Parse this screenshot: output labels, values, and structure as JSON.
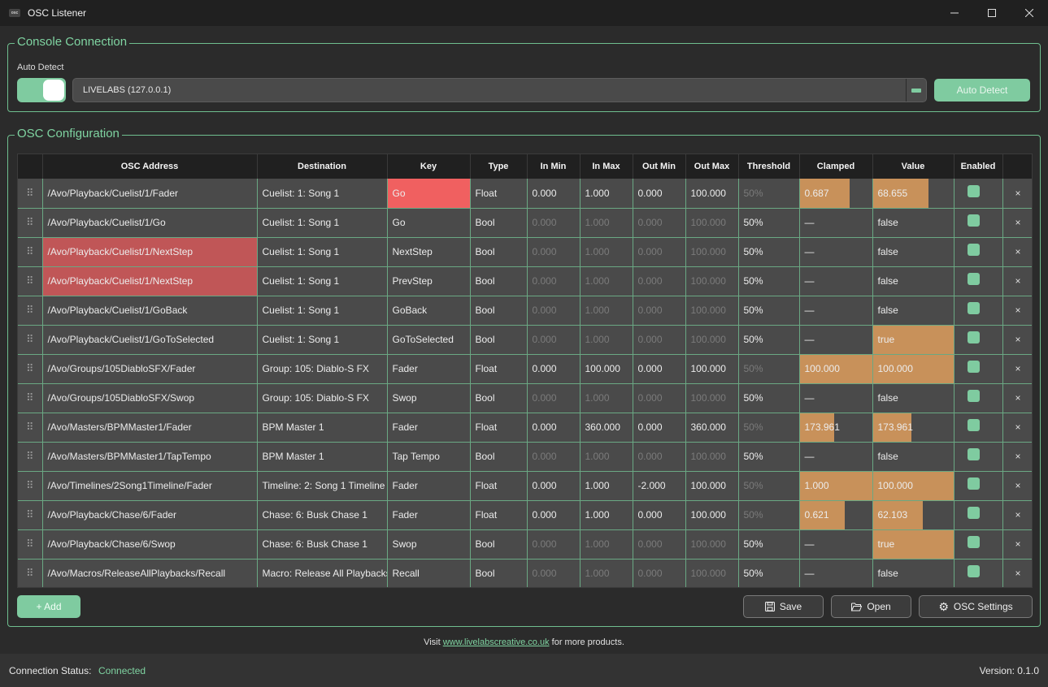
{
  "window": {
    "title": "OSC Listener",
    "icon_text": "osc"
  },
  "console": {
    "group_title": "Console Connection",
    "auto_detect_label": "Auto Detect",
    "toggle_on": true,
    "selected_console": "LIVELABS (127.0.0.1)",
    "auto_detect_button": "Auto Detect"
  },
  "osc": {
    "group_title": "OSC Configuration",
    "columns": [
      "",
      "OSC Address",
      "Destination",
      "Key",
      "Type",
      "In Min",
      "In Max",
      "Out Min",
      "Out Max",
      "Threshold",
      "Clamped",
      "Value",
      "Enabled",
      ""
    ],
    "rows": [
      {
        "address": "/Avo/Playback/Cuelist/1/Fader",
        "destination": "Cuelist: 1: Song 1",
        "key": "Go",
        "type": "Float",
        "in_min": "0.000",
        "in_max": "1.000",
        "out_min": "0.000",
        "out_max": "100.000",
        "threshold": "50%",
        "clamped": "0.687",
        "clamped_fill": 0.687,
        "value": "68.655",
        "value_fill": 0.687,
        "enabled": true,
        "address_error": false,
        "key_error": true,
        "numeric_active": true
      },
      {
        "address": "/Avo/Playback/Cuelist/1/Go",
        "destination": "Cuelist: 1: Song 1",
        "key": "Go",
        "type": "Bool",
        "in_min": "0.000",
        "in_max": "1.000",
        "out_min": "0.000",
        "out_max": "100.000",
        "threshold": "50%",
        "clamped": "—",
        "clamped_fill": 0,
        "value": "false",
        "value_fill": 0,
        "enabled": true,
        "address_error": false,
        "key_error": false,
        "numeric_active": false
      },
      {
        "address": "/Avo/Playback/Cuelist/1/NextStep",
        "destination": "Cuelist: 1: Song 1",
        "key": "NextStep",
        "type": "Bool",
        "in_min": "0.000",
        "in_max": "1.000",
        "out_min": "0.000",
        "out_max": "100.000",
        "threshold": "50%",
        "clamped": "—",
        "clamped_fill": 0,
        "value": "false",
        "value_fill": 0,
        "enabled": true,
        "address_error": true,
        "key_error": false,
        "numeric_active": false
      },
      {
        "address": "/Avo/Playback/Cuelist/1/NextStep",
        "destination": "Cuelist: 1: Song 1",
        "key": "PrevStep",
        "type": "Bool",
        "in_min": "0.000",
        "in_max": "1.000",
        "out_min": "0.000",
        "out_max": "100.000",
        "threshold": "50%",
        "clamped": "—",
        "clamped_fill": 0,
        "value": "false",
        "value_fill": 0,
        "enabled": true,
        "address_error": true,
        "key_error": false,
        "numeric_active": false
      },
      {
        "address": "/Avo/Playback/Cuelist/1/GoBack",
        "destination": "Cuelist: 1: Song 1",
        "key": "GoBack",
        "type": "Bool",
        "in_min": "0.000",
        "in_max": "1.000",
        "out_min": "0.000",
        "out_max": "100.000",
        "threshold": "50%",
        "clamped": "—",
        "clamped_fill": 0,
        "value": "false",
        "value_fill": 0,
        "enabled": true,
        "address_error": false,
        "key_error": false,
        "numeric_active": false
      },
      {
        "address": "/Avo/Playback/Cuelist/1/GoToSelected",
        "destination": "Cuelist: 1: Song 1",
        "key": "GoToSelected",
        "type": "Bool",
        "in_min": "0.000",
        "in_max": "1.000",
        "out_min": "0.000",
        "out_max": "100.000",
        "threshold": "50%",
        "clamped": "—",
        "clamped_fill": 0,
        "value": "true",
        "value_fill": 1,
        "enabled": true,
        "address_error": false,
        "key_error": false,
        "numeric_active": false
      },
      {
        "address": "/Avo/Groups/105DiabloSFX/Fader",
        "destination": "Group: 105: Diablo-S FX",
        "key": "Fader",
        "type": "Float",
        "in_min": "0.000",
        "in_max": "100.000",
        "out_min": "0.000",
        "out_max": "100.000",
        "threshold": "50%",
        "clamped": "100.000",
        "clamped_fill": 1,
        "value": "100.000",
        "value_fill": 1,
        "enabled": true,
        "address_error": false,
        "key_error": false,
        "numeric_active": true
      },
      {
        "address": "/Avo/Groups/105DiabloSFX/Swop",
        "destination": "Group: 105: Diablo-S FX",
        "key": "Swop",
        "type": "Bool",
        "in_min": "0.000",
        "in_max": "1.000",
        "out_min": "0.000",
        "out_max": "100.000",
        "threshold": "50%",
        "clamped": "—",
        "clamped_fill": 0,
        "value": "false",
        "value_fill": 0,
        "enabled": true,
        "address_error": false,
        "key_error": false,
        "numeric_active": false
      },
      {
        "address": "/Avo/Masters/BPMMaster1/Fader",
        "destination": "BPM Master 1",
        "key": "Fader",
        "type": "Float",
        "in_min": "0.000",
        "in_max": "360.000",
        "out_min": "0.000",
        "out_max": "360.000",
        "threshold": "50%",
        "clamped": "173.961",
        "clamped_fill": 0.483,
        "value": "173.961",
        "value_fill": 0.483,
        "enabled": true,
        "address_error": false,
        "key_error": false,
        "numeric_active": true
      },
      {
        "address": "/Avo/Masters/BPMMaster1/TapTempo",
        "destination": "BPM Master 1",
        "key": "Tap Tempo",
        "type": "Bool",
        "in_min": "0.000",
        "in_max": "1.000",
        "out_min": "0.000",
        "out_max": "100.000",
        "threshold": "50%",
        "clamped": "—",
        "clamped_fill": 0,
        "value": "false",
        "value_fill": 0,
        "enabled": true,
        "address_error": false,
        "key_error": false,
        "numeric_active": false
      },
      {
        "address": "/Avo/Timelines/2Song1Timeline/Fader",
        "destination": "Timeline: 2: Song 1 Timeline",
        "key": "Fader",
        "type": "Float",
        "in_min": "0.000",
        "in_max": "1.000",
        "out_min": "-2.000",
        "out_max": "100.000",
        "threshold": "50%",
        "clamped": "1.000",
        "clamped_fill": 1,
        "value": "100.000",
        "value_fill": 1,
        "enabled": true,
        "address_error": false,
        "key_error": false,
        "numeric_active": true
      },
      {
        "address": "/Avo/Playback/Chase/6/Fader",
        "destination": "Chase: 6: Busk Chase 1",
        "key": "Fader",
        "type": "Float",
        "in_min": "0.000",
        "in_max": "1.000",
        "out_min": "0.000",
        "out_max": "100.000",
        "threshold": "50%",
        "clamped": "0.621",
        "clamped_fill": 0.621,
        "value": "62.103",
        "value_fill": 0.621,
        "enabled": true,
        "address_error": false,
        "key_error": false,
        "numeric_active": true
      },
      {
        "address": "/Avo/Playback/Chase/6/Swop",
        "destination": "Chase: 6: Busk Chase 1",
        "key": "Swop",
        "type": "Bool",
        "in_min": "0.000",
        "in_max": "1.000",
        "out_min": "0.000",
        "out_max": "100.000",
        "threshold": "50%",
        "clamped": "—",
        "clamped_fill": 0,
        "value": "true",
        "value_fill": 1,
        "enabled": true,
        "address_error": false,
        "key_error": false,
        "numeric_active": false
      },
      {
        "address": "/Avo/Macros/ReleaseAllPlaybacks/Recall",
        "destination": "Macro: Release All Playbacks",
        "key": "Recall",
        "type": "Bool",
        "in_min": "0.000",
        "in_max": "1.000",
        "out_min": "0.000",
        "out_max": "100.000",
        "threshold": "50%",
        "clamped": "—",
        "clamped_fill": 0,
        "value": "false",
        "value_fill": 0,
        "enabled": true,
        "address_error": false,
        "key_error": false,
        "numeric_active": false
      }
    ],
    "add_button": "+ Add",
    "save_button": "Save",
    "open_button": "Open",
    "settings_button": "OSC Settings"
  },
  "footer": {
    "prefix": "Visit",
    "link": "www.livelabscreative.co.uk",
    "suffix": "for more products."
  },
  "status": {
    "label": "Connection Status:",
    "value": "Connected",
    "version": "Version: 0.1.0"
  },
  "colors": {
    "accent": "#7fcba0",
    "bar": "#c8915a",
    "error": "#c05657",
    "key_error": "#f06060"
  }
}
